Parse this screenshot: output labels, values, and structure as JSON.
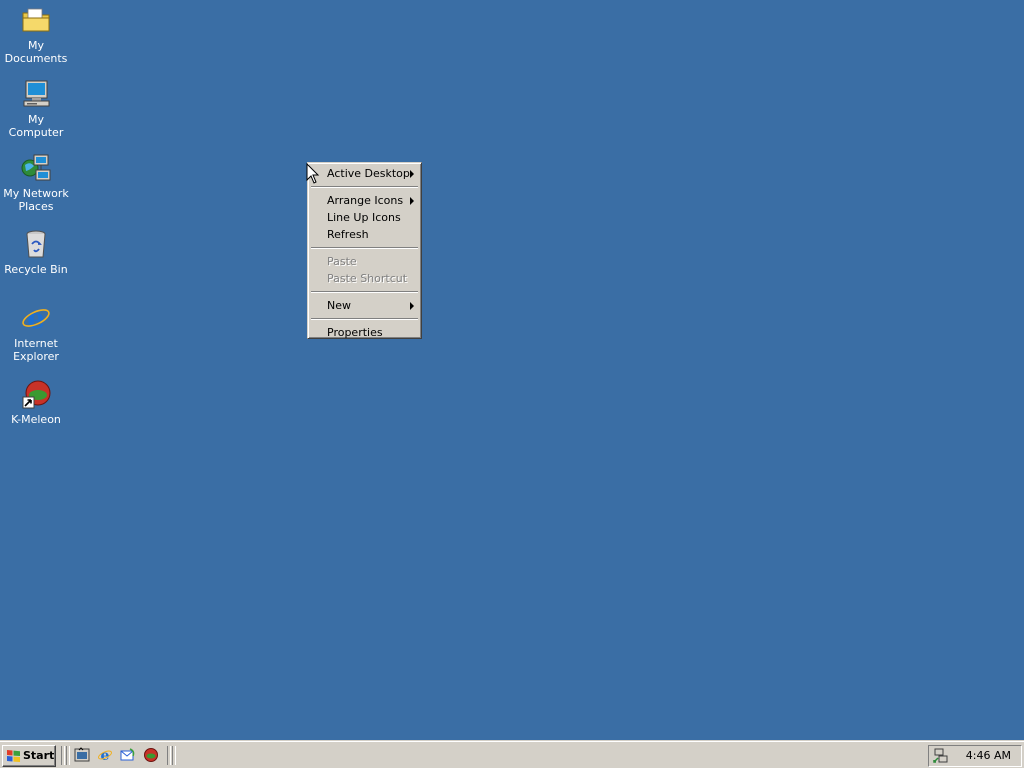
{
  "desktop": {
    "background_color": "#3a6ea5",
    "icons": [
      {
        "label": "My Documents",
        "icon": "folder-icon"
      },
      {
        "label": "My Computer",
        "icon": "computer-icon"
      },
      {
        "label": "My Network Places",
        "icon": "network-icon"
      },
      {
        "label": "Recycle Bin",
        "icon": "recycle-bin-icon"
      },
      {
        "label": "Internet Explorer",
        "icon": "internet-explorer-icon"
      },
      {
        "label": "K-Meleon",
        "icon": "k-meleon-icon"
      }
    ]
  },
  "context_menu": {
    "items": [
      {
        "label": "Active Desktop",
        "submenu": true,
        "enabled": true
      },
      {
        "label": "Arrange Icons",
        "submenu": true,
        "enabled": true
      },
      {
        "label": "Line Up Icons",
        "submenu": false,
        "enabled": true
      },
      {
        "label": "Refresh",
        "submenu": false,
        "enabled": true
      },
      {
        "label": "Paste",
        "submenu": false,
        "enabled": false
      },
      {
        "label": "Paste Shortcut",
        "submenu": false,
        "enabled": false
      },
      {
        "label": "New",
        "submenu": true,
        "enabled": true
      },
      {
        "label": "Properties",
        "submenu": false,
        "enabled": true
      }
    ]
  },
  "taskbar": {
    "start_label": "Start",
    "quick_launch": [
      "show-desktop-icon",
      "internet-explorer-icon",
      "outlook-express-icon",
      "k-meleon-icon"
    ],
    "tray_icon": "network-tray-icon",
    "clock": "4:46 AM"
  }
}
